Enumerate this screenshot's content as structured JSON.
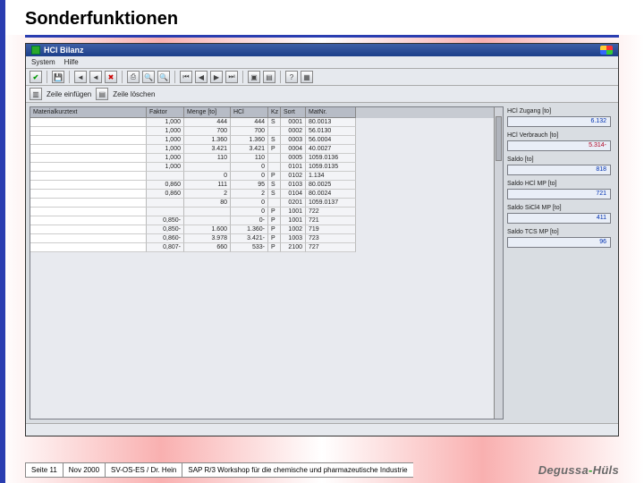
{
  "slide": {
    "title": "Sonderfunktionen"
  },
  "app": {
    "title": "HCl Bilanz",
    "menu": [
      "System",
      "Hilfe"
    ],
    "toolbar2": {
      "insert": "Zeile einfügen",
      "delete": "Zeile löschen"
    }
  },
  "grid": {
    "headers": [
      "Materialkurztext",
      "Faktor",
      "Menge [to]",
      "HCl",
      "Kz",
      "Sort",
      "MatNr."
    ],
    "rows": [
      {
        "mat": "",
        "faktor": "1,000",
        "menge": "444",
        "hcl": "444",
        "kz": "S",
        "sort": "0001",
        "matnr": "80.0013"
      },
      {
        "mat": "",
        "faktor": "1,000",
        "menge": "700",
        "hcl": "700",
        "kz": "",
        "sort": "0002",
        "matnr": "56.0130"
      },
      {
        "mat": "",
        "faktor": "1,000",
        "menge": "1.360",
        "hcl": "1.360",
        "kz": "S",
        "sort": "0003",
        "matnr": "56.0004"
      },
      {
        "mat": "",
        "faktor": "1,000",
        "menge": "3.421",
        "hcl": "3.421",
        "kz": "P",
        "sort": "0004",
        "matnr": "40.0027"
      },
      {
        "mat": "",
        "faktor": "1,000",
        "menge": "110",
        "hcl": "110",
        "kz": "",
        "sort": "0005",
        "matnr": "1059.0136"
      },
      {
        "mat": "",
        "faktor": "1,000",
        "menge": "",
        "hcl": "0",
        "kz": "",
        "sort": "0101",
        "matnr": "1059.0135"
      },
      {
        "mat": "",
        "faktor": "",
        "menge": "0",
        "hcl": "0",
        "kz": "P",
        "sort": "0102",
        "matnr": "1.134"
      },
      {
        "mat": "",
        "faktor": "0,860",
        "menge": "111",
        "hcl": "95",
        "kz": "S",
        "sort": "0103",
        "matnr": "80.0025"
      },
      {
        "mat": "",
        "faktor": "0,860",
        "menge": "2",
        "hcl": "2",
        "kz": "S",
        "sort": "0104",
        "matnr": "80.0024"
      },
      {
        "mat": "",
        "faktor": "",
        "menge": "80",
        "hcl": "0",
        "kz": "",
        "sort": "0201",
        "matnr": "1059.0137"
      },
      {
        "mat": "",
        "faktor": "",
        "menge": "",
        "hcl": "0",
        "kz": "P",
        "sort": "1001",
        "matnr": "722"
      },
      {
        "mat": "",
        "faktor": "0,850-",
        "menge": "",
        "hcl": "0-",
        "kz": "P",
        "sort": "1001",
        "matnr": "721"
      },
      {
        "mat": "",
        "faktor": "0,850-",
        "menge": "1.600",
        "hcl": "1.360-",
        "kz": "P",
        "sort": "1002",
        "matnr": "719"
      },
      {
        "mat": "",
        "faktor": "0,860-",
        "menge": "3.978",
        "hcl": "3.421-",
        "kz": "P",
        "sort": "1003",
        "matnr": "723"
      },
      {
        "mat": "",
        "faktor": "0,807-",
        "menge": "660",
        "hcl": "533-",
        "kz": "P",
        "sort": "2100",
        "matnr": "727"
      }
    ]
  },
  "side": [
    {
      "label": "HCl Zugang [to]",
      "value": "6.132",
      "cls": ""
    },
    {
      "label": "HCl Verbrauch [to]",
      "value": "5.314-",
      "cls": "red"
    },
    {
      "label": "Saldo [to]",
      "value": "818",
      "cls": ""
    },
    {
      "label": "Saldo HCl MP [to]",
      "value": "721",
      "cls": ""
    },
    {
      "label": "Saldo SiCl4 MP [to]",
      "value": "411",
      "cls": ""
    },
    {
      "label": "Saldo TCS MP [to]",
      "value": "96",
      "cls": ""
    }
  ],
  "footer": {
    "page": "Seite 11",
    "date": "Nov 2000",
    "author": "SV-OS-ES / Dr. Hein",
    "event": "SAP R/3 Workshop für die chemische und pharmazeutische Industrie",
    "company": "Degussa-Hüls"
  }
}
